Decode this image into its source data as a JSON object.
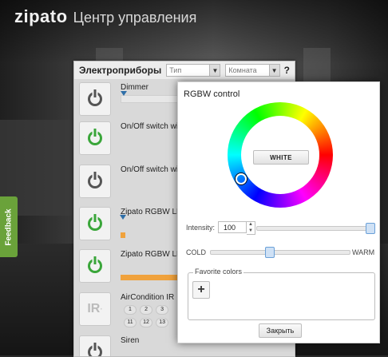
{
  "app": {
    "logo_text": "zipato",
    "title": "Центр управления",
    "feedback_tab": "Feedback"
  },
  "panel": {
    "title": "Электроприборы",
    "filter_type": "Тип",
    "filter_room": "Комната",
    "help": "?",
    "devices": [
      {
        "name": "Dimmer",
        "power_state": "off"
      },
      {
        "name": "On/Off switch wi",
        "power_state": "on"
      },
      {
        "name": "On/Off switch wi",
        "power_state": "off"
      },
      {
        "name": "Zipato RGBW LE",
        "power_state": "on"
      },
      {
        "name": "Zipato RGBW LE",
        "power_state": "on"
      },
      {
        "name": "AirCondition IR",
        "power_state": "ir"
      },
      {
        "name": "Siren",
        "power_state": "off"
      }
    ],
    "ir_buttons": [
      "1",
      "2",
      "3",
      "11",
      "12",
      "13"
    ],
    "ir_logo": "IR"
  },
  "dialog": {
    "title": "RGBW control",
    "white_button": "WHITE",
    "intensity_label": "Intensity:",
    "intensity_value": "100",
    "intensity_level_percent": 100,
    "temp_left_label": "COLD",
    "temp_right_label": "WARM",
    "temp_level_percent": 42,
    "favorites_label": "Favorite colors",
    "add_icon": "+",
    "close_button": "Закрыть"
  }
}
